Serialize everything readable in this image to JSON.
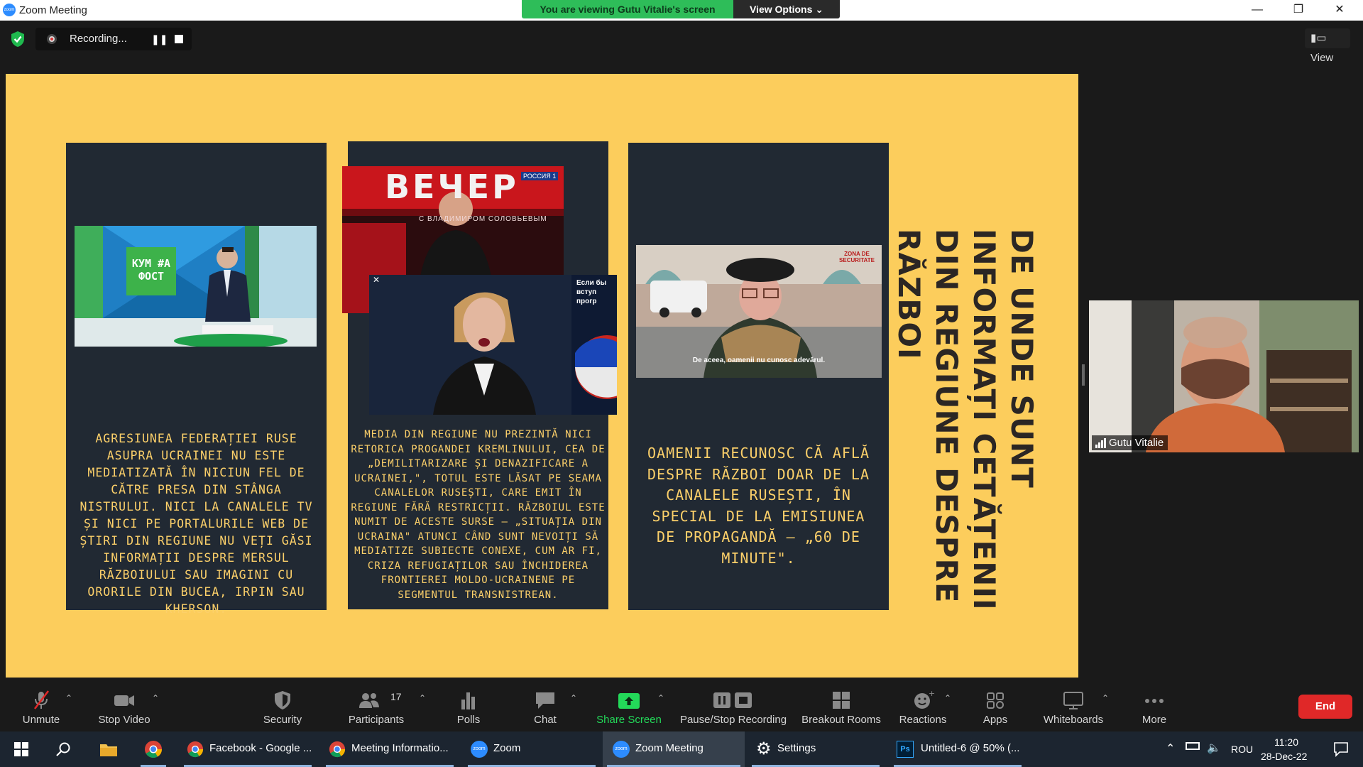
{
  "titlebar": {
    "app_title": "Zoom Meeting",
    "viewing_banner": "You are viewing Gutu Vitalie's screen",
    "view_options": "View Options"
  },
  "meeting": {
    "recording_label": "Recording...",
    "view_button": "View"
  },
  "slide": {
    "title": "De unde sunt informați cetățenii din regiune despre război",
    "card1_text": "Agresiunea Federației Ruse asupra Ucrainei nu este mediatizată în niciun fel de către presa din stânga Nistrului. Nici la canalele TV și nici pe portalurile web de știri din regiune nu veți găsi informații despre mersul războiului sau imagini cu ororile din Bucea, Irpin sau Kherson.",
    "card2_text": "Media din regiune nu prezintă nici retorica progandei Kremlinului, cea de „demilitarizare și denazificare a Ucrainei,\", totul este lăsat pe seama canalelor rusești, care emit în regiune fără restricții. Războiul este numit de aceste surse – „situația din Ucraina\" atunci când sunt nevoiți să mediatize subiecte conexe, cum ar fi, criza refugiaților sau închiderea frontierei moldo-ucrainene pe segmentul transnistrean.",
    "card3_text": "Oamenii recunosc că află despre război doar de la canalele rusești, în special de la emisiunea de propagandă – „60 de minute\".",
    "img1_logo": "КУМ #А ФОСТ",
    "img2_banner": "ВЕЧЕР",
    "img2_channel": "РОССИЯ 1",
    "img2_caption": "С ВЛАДИМИРОМ СОЛОВЬЕВЫМ",
    "img2_side": "Если бы вступ прогр",
    "img3_caption": "De aceea, oamenii nu cunosc adevărul.",
    "img3_tag": "ZONA DE SECURITATE"
  },
  "participant": {
    "name": "Gutu Vitalie"
  },
  "toolbar": {
    "unmute": "Unmute",
    "stop_video": "Stop Video",
    "security": "Security",
    "participants": "Participants",
    "participants_count": "17",
    "polls": "Polls",
    "chat": "Chat",
    "share_screen": "Share Screen",
    "pause_stop_recording": "Pause/Stop Recording",
    "breakout_rooms": "Breakout Rooms",
    "reactions": "Reactions",
    "apps": "Apps",
    "whiteboards": "Whiteboards",
    "more": "More",
    "end": "End"
  },
  "taskbar": {
    "items": [
      {
        "label": "Facebook - Google ..."
      },
      {
        "label": "Meeting Informatio..."
      },
      {
        "label": "Zoom"
      },
      {
        "label": "Zoom Meeting"
      },
      {
        "label": "Settings"
      },
      {
        "label": "Untitled-6 @ 50% (..."
      }
    ],
    "language": "ROU",
    "time": "11:20",
    "date": "28-Dec-22"
  },
  "colors": {
    "slide_bg": "#fccd5c",
    "card_bg": "#212933",
    "card_text": "#fcd06a",
    "banner_green": "#2ebd59",
    "share_green": "#23d959",
    "end_red": "#e02828"
  }
}
